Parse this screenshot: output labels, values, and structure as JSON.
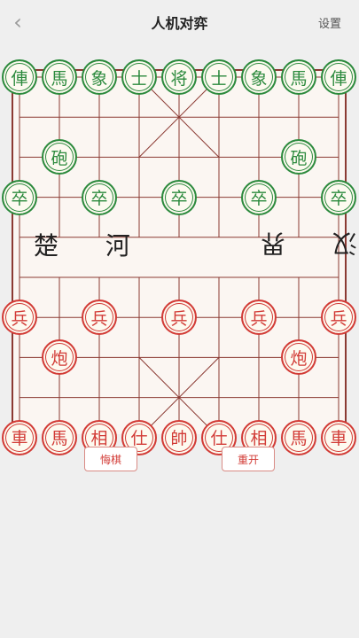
{
  "header": {
    "back_icon": "‹",
    "title": "人机对弈",
    "settings_label": "设置"
  },
  "river": {
    "left_text": "楚 河",
    "right_text": "汉 界"
  },
  "buttons": {
    "undo_label": "悔棋",
    "restart_label": "重开"
  },
  "colors": {
    "black": "#2c8a3d",
    "red": "#d23b36",
    "board_line": "#8b3a33"
  },
  "pieces": {
    "black": [
      {
        "char": "俥",
        "col": 0,
        "row": 0
      },
      {
        "char": "馬",
        "col": 1,
        "row": 0
      },
      {
        "char": "象",
        "col": 2,
        "row": 0
      },
      {
        "char": "士",
        "col": 3,
        "row": 0
      },
      {
        "char": "将",
        "col": 4,
        "row": 0
      },
      {
        "char": "士",
        "col": 5,
        "row": 0
      },
      {
        "char": "象",
        "col": 6,
        "row": 0
      },
      {
        "char": "馬",
        "col": 7,
        "row": 0
      },
      {
        "char": "俥",
        "col": 8,
        "row": 0
      },
      {
        "char": "砲",
        "col": 1,
        "row": 2
      },
      {
        "char": "砲",
        "col": 7,
        "row": 2
      },
      {
        "char": "卒",
        "col": 0,
        "row": 3
      },
      {
        "char": "卒",
        "col": 2,
        "row": 3
      },
      {
        "char": "卒",
        "col": 4,
        "row": 3
      },
      {
        "char": "卒",
        "col": 6,
        "row": 3
      },
      {
        "char": "卒",
        "col": 8,
        "row": 3
      }
    ],
    "red": [
      {
        "char": "兵",
        "col": 0,
        "row": 6
      },
      {
        "char": "兵",
        "col": 2,
        "row": 6
      },
      {
        "char": "兵",
        "col": 4,
        "row": 6
      },
      {
        "char": "兵",
        "col": 6,
        "row": 6
      },
      {
        "char": "兵",
        "col": 8,
        "row": 6
      },
      {
        "char": "炮",
        "col": 1,
        "row": 7
      },
      {
        "char": "炮",
        "col": 7,
        "row": 7
      },
      {
        "char": "車",
        "col": 0,
        "row": 9
      },
      {
        "char": "馬",
        "col": 1,
        "row": 9
      },
      {
        "char": "相",
        "col": 2,
        "row": 9
      },
      {
        "char": "仕",
        "col": 3,
        "row": 9
      },
      {
        "char": "帥",
        "col": 4,
        "row": 9
      },
      {
        "char": "仕",
        "col": 5,
        "row": 9
      },
      {
        "char": "相",
        "col": 6,
        "row": 9
      },
      {
        "char": "馬",
        "col": 7,
        "row": 9
      },
      {
        "char": "車",
        "col": 8,
        "row": 9
      }
    ]
  }
}
